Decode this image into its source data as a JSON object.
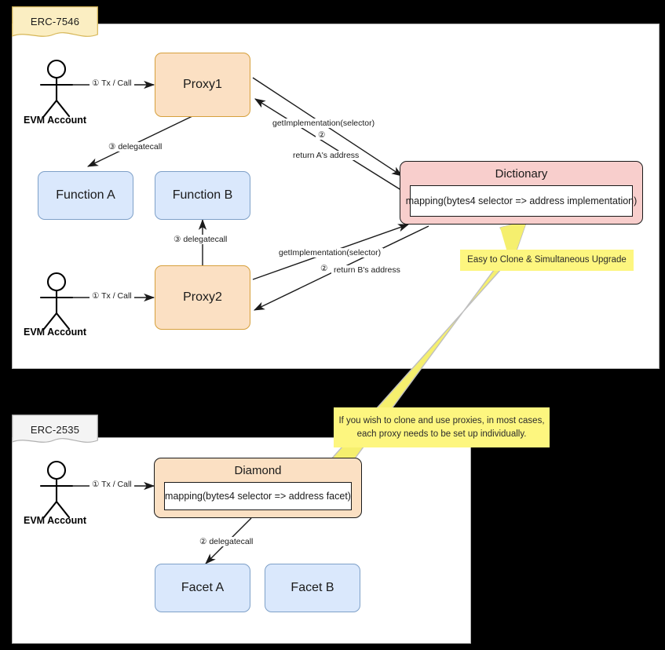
{
  "panels": {
    "top": {
      "tab_label": "ERC-7546"
    },
    "bottom": {
      "tab_label": "ERC-2535"
    }
  },
  "top_section": {
    "actors": [
      {
        "name": "actor-evm-account-1",
        "caption": "EVM Account"
      },
      {
        "name": "actor-evm-account-2",
        "caption": "EVM Account"
      }
    ],
    "nodes": {
      "proxy1": "Proxy1",
      "proxy2": "Proxy2",
      "function_a": "Function A",
      "function_b": "Function B",
      "dictionary_title": "Dictionary",
      "dictionary_mapping": "mapping(bytes4 selector => address implementation)"
    },
    "edges": [
      {
        "id": "edge-account1-proxy1",
        "label": "① Tx / Call"
      },
      {
        "id": "edge-proxy1-functiona",
        "label": "③ delegatecall"
      },
      {
        "id": "edge-proxy1-dictionary",
        "label": "getImplementation(selector)",
        "step": "②"
      },
      {
        "id": "edge-dictionary-proxy1",
        "label": "return A's address"
      },
      {
        "id": "edge-account2-proxy2",
        "label": "① Tx / Call"
      },
      {
        "id": "edge-proxy2-functionb",
        "label": "③ delegatecall"
      },
      {
        "id": "edge-proxy2-dictionary",
        "label": "getImplementation(selector)",
        "step": "②"
      },
      {
        "id": "edge-dictionary-proxy2",
        "label": "return B's address"
      }
    ]
  },
  "bottom_section": {
    "actors": [
      {
        "name": "actor-evm-account-3",
        "caption": "EVM Account"
      }
    ],
    "nodes": {
      "diamond_title": "Diamond",
      "diamond_mapping": "mapping(bytes4 selector => address facet)",
      "facet_a": "Facet A",
      "facet_b": "Facet B"
    },
    "edges": [
      {
        "id": "edge-account3-diamond",
        "label": "① Tx / Call"
      },
      {
        "id": "edge-diamond-faceta",
        "label": "② delegatecall"
      }
    ]
  },
  "callouts": {
    "upgrade_note": "Easy to Clone & Simultaneous Upgrade",
    "clone_note_line1": "If you wish to clone and use proxies, in most cases,",
    "clone_note_line2": "each proxy needs to be set up individually."
  },
  "colors": {
    "background": "#000000",
    "panel": "#ffffff",
    "orange_fill": "#fbe0c3",
    "orange_stroke": "#d6a03c",
    "blue_fill": "#dae8fc",
    "blue_stroke": "#7ea0c8",
    "pink_fill": "#f8cecc",
    "pink_stroke": "#c0716d",
    "note_yellow": "#fdf67f",
    "tab_yellow": "#fbeec2",
    "tab_gray": "#f4f4f4",
    "arrow_black": "#1a1a1a",
    "big_arrow_yellow": "#f5ef6e"
  }
}
